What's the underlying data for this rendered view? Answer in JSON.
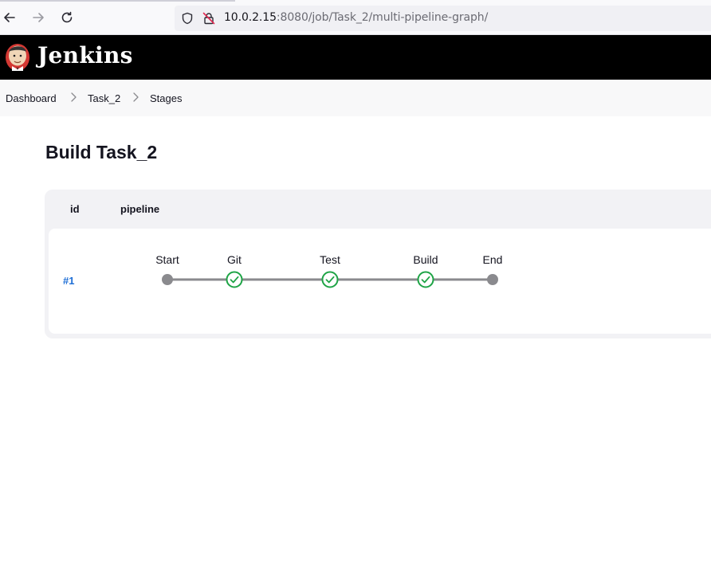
{
  "browser": {
    "url_host": "10.0.2.15",
    "url_rest": ":8080/job/Task_2/multi-pipeline-graph/"
  },
  "header": {
    "brand": "Jenkins"
  },
  "breadcrumb": {
    "items": [
      "Dashboard",
      "Task_2",
      "Stages"
    ]
  },
  "main": {
    "title": "Build Task_2",
    "table": {
      "columns": [
        "id",
        "pipeline"
      ],
      "rows": [
        {
          "id": "#1",
          "stages": [
            {
              "name": "Start",
              "status": "terminal"
            },
            {
              "name": "Git",
              "status": "success"
            },
            {
              "name": "Test",
              "status": "success"
            },
            {
              "name": "Build",
              "status": "success"
            },
            {
              "name": "End",
              "status": "terminal"
            }
          ]
        }
      ]
    }
  },
  "colors": {
    "success": "#1ea446",
    "terminal": "#8a8a8e",
    "link": "#1f6fd6",
    "header_bg": "#000000"
  }
}
